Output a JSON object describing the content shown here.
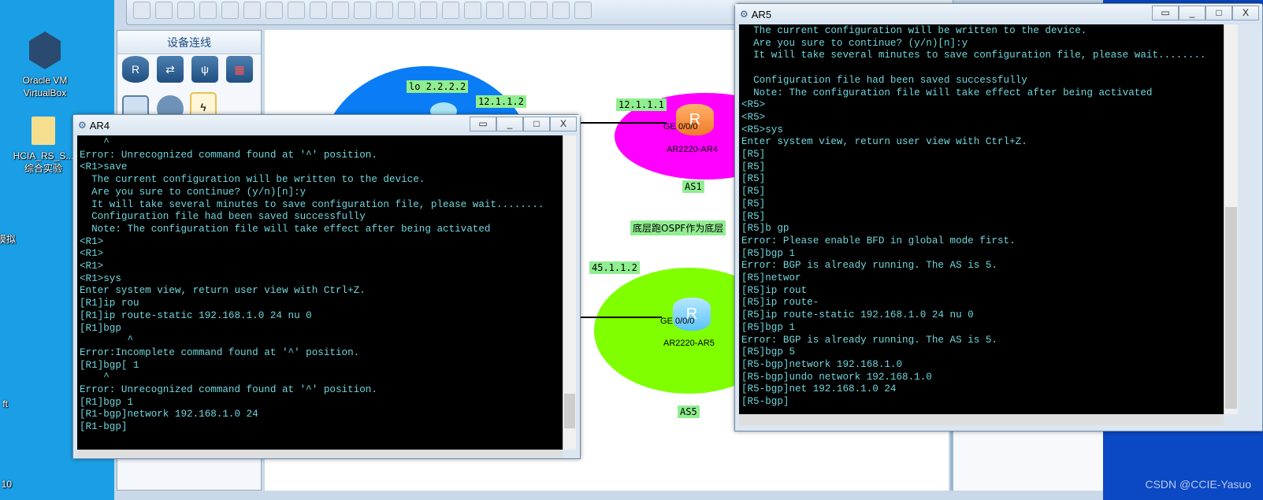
{
  "desktop": {
    "icons": [
      {
        "label": "Oracle VM\nVirtualBox",
        "icon": "virtualbox-icon"
      },
      {
        "label": "HCIA_RS_S...\n综合实验",
        "icon": "folder-icon"
      },
      {
        "label": "模拟",
        "icon": "app-icon"
      },
      {
        "label": "ft",
        "icon": "app-icon"
      },
      {
        "label": "10",
        "icon": "app-icon"
      }
    ],
    "watermark": "CSDN @CCIE-Yasuo"
  },
  "ensp": {
    "panel_title": "设备连线",
    "devices": [
      "router-icon",
      "switch-icon",
      "wireless-icon",
      "firewall-icon",
      "pc-icon",
      "cloud-icon",
      "cable-icon"
    ],
    "canvas": {
      "labels": {
        "lo": "lo 2.2.2.2",
        "ip_ar4_peer": "12.1.1.2",
        "ip_ar4": "12.1.1.1",
        "ip_ar5": "45.1.1.2",
        "as1": "AS1",
        "as5": "AS5",
        "note": "底层跑OSPF作为底层"
      },
      "routers": [
        {
          "name": "AR2220-AR4",
          "port": "GE 0/0/0",
          "color": "#f08a3c"
        },
        {
          "name": "AR2220-AR5",
          "port": "GE 0/0/0",
          "color": "#5cc3f5"
        }
      ],
      "colors": {
        "as_top": "#0a7cf5",
        "as1": "#ff00ff",
        "as5": "#7fff00"
      }
    }
  },
  "windows": [
    {
      "title": "AR4",
      "lines": [
        "    ^",
        "Error: Unrecognized command found at '^' position.",
        "<R1>save",
        "  The current configuration will be written to the device.",
        "  Are you sure to continue? (y/n)[n]:y",
        "  It will take several minutes to save configuration file, please wait........",
        "  Configuration file had been saved successfully",
        "  Note: The configuration file will take effect after being activated",
        "<R1>",
        "<R1>",
        "<R1>",
        "<R1>sys",
        "Enter system view, return user view with Ctrl+Z.",
        "[R1]ip rou",
        "[R1]ip route-static 192.168.1.0 24 nu 0",
        "[R1]bgp",
        "        ^",
        "Error:Incomplete command found at '^' position.",
        "[R1]bgp[ 1",
        "    ^",
        "Error: Unrecognized command found at '^' position.",
        "[R1]bgp 1",
        "[R1-bgp]network 192.168.1.0 24",
        "[R1-bgp]"
      ]
    },
    {
      "title": "AR5",
      "lines": [
        "  The current configuration will be written to the device.",
        "  Are you sure to continue? (y/n)[n]:y",
        "  It will take several minutes to save configuration file, please wait........",
        "",
        "  Configuration file had been saved successfully",
        "  Note: The configuration file will take effect after being activated",
        "<R5>",
        "<R5>",
        "<R5>sys",
        "Enter system view, return user view with Ctrl+Z.",
        "[R5]",
        "[R5]",
        "[R5]",
        "[R5]",
        "[R5]",
        "[R5]",
        "[R5]b gp",
        "Error: Please enable BFD in global mode first.",
        "[R5]bgp 1",
        "Error: BGP is already running. The AS is 5.",
        "[R5]networ",
        "[R5]ip rout",
        "[R5]ip route-",
        "[R5]ip route-static 192.168.1.0 24 nu 0",
        "[R5]bgp 1",
        "Error: BGP is already running. The AS is 5.",
        "[R5]bgp 5",
        "[R5-bgp]network 192.168.1.0",
        "[R5-bgp]undo network 192.168.1.0",
        "[R5-bgp]net 192.168.1.0 24",
        "[R5-bgp]"
      ]
    }
  ],
  "window_buttons": {
    "restore": "▭",
    "minimize": "_",
    "maximize": "□",
    "close": "X"
  }
}
